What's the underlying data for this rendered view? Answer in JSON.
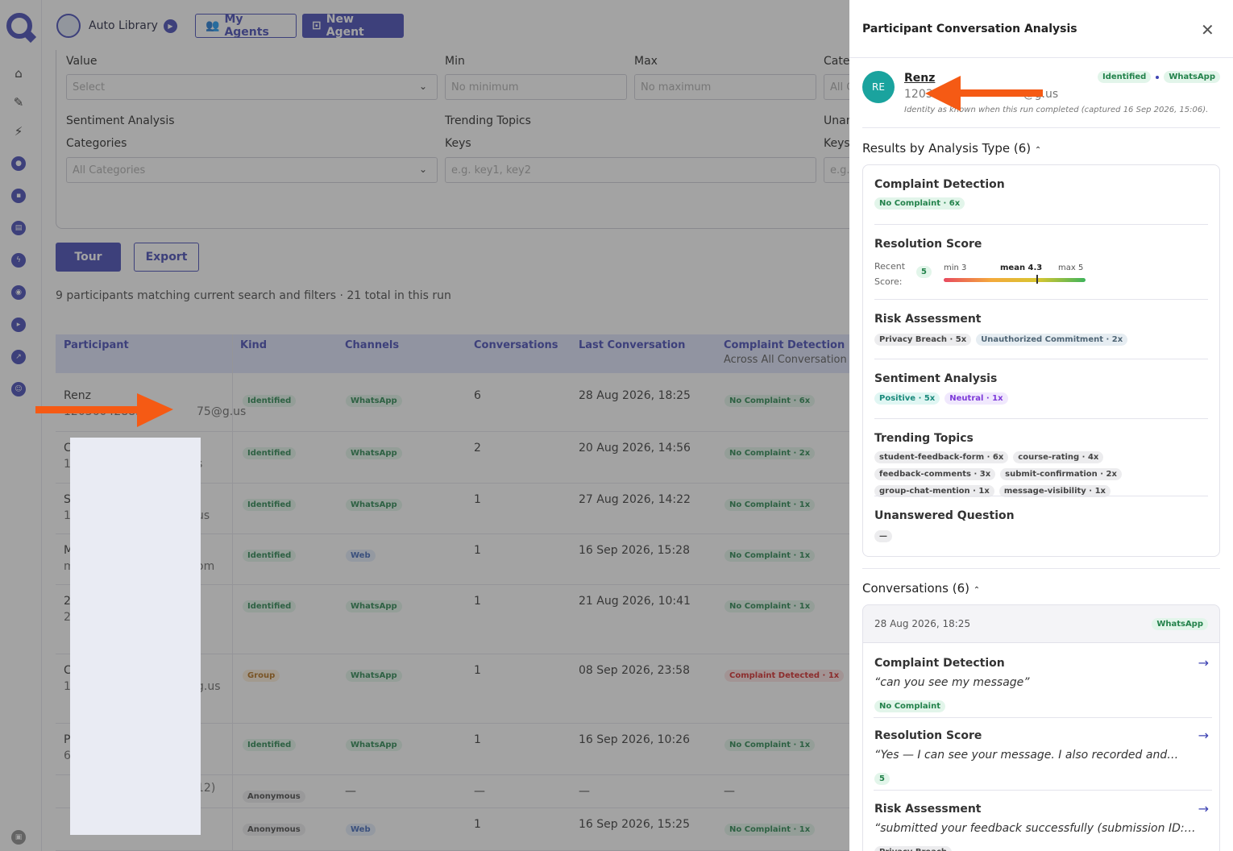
{
  "app": {
    "name": "Auto Library",
    "my_agents": "My Agents",
    "new_agent": "New Agent"
  },
  "filters": {
    "value_label": "Value",
    "value_placeholder": "Select",
    "min_label": "Min",
    "min_placeholder": "No minimum",
    "max_label": "Max",
    "max_placeholder": "No maximum",
    "cate_label": "Cate",
    "cate_placeholder": "All C",
    "sentiment_label": "Sentiment Analysis",
    "categories_label": "Categories",
    "categories_placeholder": "All Categories",
    "trending_label": "Trending Topics",
    "keys_label": "Keys",
    "keys_placeholder": "e.g. key1, key2",
    "unan_label": "Unan",
    "keys2_label": "Keys",
    "keys2_placeholder": "e.g."
  },
  "actions": {
    "tour": "Tour",
    "export": "Export"
  },
  "summary": "9 participants matching current search and filters · 21 total in this run",
  "table": {
    "headers": {
      "participant": "Participant",
      "kind": "Kind",
      "channels": "Channels",
      "conversations": "Conversations",
      "last": "Last Conversation",
      "complaint": "Complaint Detection",
      "complaint_sub": "Across All Conversation"
    },
    "rows": [
      {
        "name": "Renz",
        "id": "12036042883",
        "id_tail": "75@g.us",
        "kind": "Identified",
        "channel": "WhatsApp",
        "conv": "6",
        "last": "28 Aug 2026, 18:25",
        "complaint": "No Complaint · 6x"
      },
      {
        "name": "C",
        "id": "12",
        "id_tail": "s",
        "kind": "Identified",
        "channel": "WhatsApp",
        "conv": "2",
        "last": "20 Aug 2026, 14:56",
        "complaint": "No Complaint · 2x"
      },
      {
        "name": "S",
        "id": "12",
        "id_tail": "us",
        "kind": "Identified",
        "channel": "WhatsApp",
        "conv": "1",
        "last": "27 Aug 2026, 14:22",
        "complaint": "No Complaint · 1x"
      },
      {
        "name": "M",
        "id": "m",
        "id_tail": "om",
        "kind": "Identified",
        "channel": "Web",
        "conv": "1",
        "last": "16 Sep 2026, 15:28",
        "complaint": "No Complaint · 1x"
      },
      {
        "name": "2",
        "id": "2",
        "id_tail": "",
        "kind": "Identified",
        "channel": "WhatsApp",
        "conv": "1",
        "last": "21 Aug 2026, 10:41",
        "complaint": "No Complaint · 1x"
      },
      {
        "name": "C",
        "id": "12",
        "id_tail": "g.us",
        "kind": "Group",
        "channel": "WhatsApp",
        "conv": "1",
        "last": "08 Sep 2026, 23:58",
        "complaint": "Complaint Detected · 1x"
      },
      {
        "name": "P",
        "id": "6",
        "id_tail": "",
        "kind": "Identified",
        "channel": "WhatsApp",
        "conv": "1",
        "last": "16 Sep 2026, 10:26",
        "complaint": "No Complaint · 1x"
      },
      {
        "name": "",
        "id": "",
        "id_tail": "12)",
        "kind": "Anonymous",
        "channel": "—",
        "conv": "—",
        "last": "—",
        "complaint": "—"
      },
      {
        "name": "",
        "id": "",
        "id_tail": "",
        "kind": "Anonymous",
        "channel": "Web",
        "conv": "1",
        "last": "16 Sep 2026, 15:25",
        "complaint": "No Complaint · 1x"
      }
    ]
  },
  "drawer": {
    "title": "Participant Conversation Analysis",
    "participant": {
      "initials": "RE",
      "name": "Renz",
      "id_head": "1203",
      "id_tail": "@g.us",
      "note": "Identity as known when this run completed (captured 16 Sep 2026, 15:06).",
      "badge1": "Identified",
      "badge2": "WhatsApp"
    },
    "results_heading": "Results by Analysis Type (6)",
    "complaint": {
      "title": "Complaint Detection",
      "badge": "No Complaint · 6x"
    },
    "resolution": {
      "title": "Resolution Score",
      "recent_label": "Recent",
      "score_label": "Score:",
      "recent_value": "5",
      "min": "min 3",
      "mean": "mean 4.3",
      "max": "max 5"
    },
    "risk": {
      "title": "Risk Assessment",
      "b1": "Privacy Breach · 5x",
      "b2": "Unauthorized Commitment · 2x"
    },
    "sentiment": {
      "title": "Sentiment Analysis",
      "b1": "Positive · 5x",
      "b2": "Neutral · 1x"
    },
    "trending": {
      "title": "Trending Topics",
      "tags": [
        "student-feedback-form · 6x",
        "course-rating · 4x",
        "feedback-comments · 3x",
        "submit-confirmation · 2x",
        "group-chat-mention · 1x",
        "message-visibility · 1x"
      ]
    },
    "unanswered": {
      "title": "Unanswered Question",
      "value": "—"
    },
    "conversations_heading": "Conversations (6)",
    "conv": {
      "date": "28 Aug 2026, 18:25",
      "channel": "WhatsApp",
      "items": [
        {
          "title": "Complaint Detection",
          "quote": "“can you see my message”",
          "badge": "No Complaint"
        },
        {
          "title": "Resolution Score",
          "quote": "“Yes — I can see your message. I also recorded and…",
          "badge": "5"
        },
        {
          "title": "Risk Assessment",
          "quote": "“submitted your feedback successfully (submission ID:…",
          "badge": "Privacy Breach"
        }
      ]
    }
  }
}
